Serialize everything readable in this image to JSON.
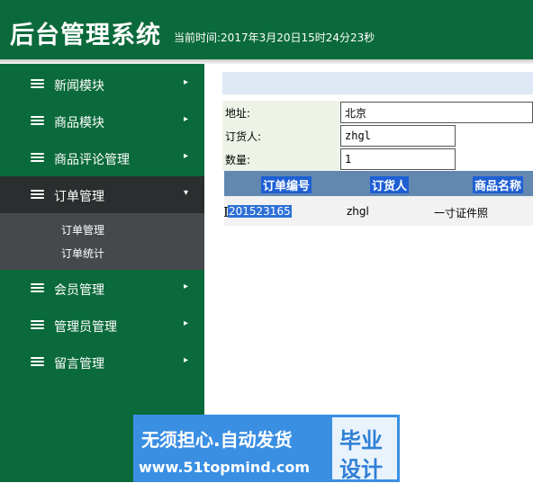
{
  "header": {
    "title": "后台管理系统",
    "time": "当前时间:2017年3月20日15时24分23秒"
  },
  "sidebar": {
    "items": [
      {
        "label": "新闻模块",
        "arrow": "▸"
      },
      {
        "label": "商品模块",
        "arrow": "▸"
      },
      {
        "label": "商品评论管理",
        "arrow": "▸"
      },
      {
        "label": "订单管理",
        "arrow": "▾",
        "active": true
      },
      {
        "label": "会员管理",
        "arrow": "▸"
      },
      {
        "label": "管理员管理",
        "arrow": "▸"
      },
      {
        "label": "留言管理",
        "arrow": "▸"
      }
    ],
    "submenu": [
      "订单管理",
      "订单统计"
    ]
  },
  "form": {
    "address_label": "地址:",
    "address_value": "北京",
    "buyer_label": "订货人:",
    "buyer_value": "zhgl",
    "qty_label": "数量:",
    "qty_value": "1"
  },
  "grid": {
    "columns": [
      "订单编号",
      "订货人",
      "商品名称"
    ],
    "rows": [
      {
        "order_no": "201523165",
        "buyer": "zhgl",
        "product": "一寸证件照"
      }
    ]
  },
  "watermark": {
    "line1": "无须担心.自动发货",
    "line2": "www.51topmind.com",
    "right1": "毕业",
    "right2": "设计"
  },
  "colors": {
    "brand": "#0b6a3b",
    "active_menu": "#2b2e2f",
    "grid_header": "#6288b0"
  }
}
